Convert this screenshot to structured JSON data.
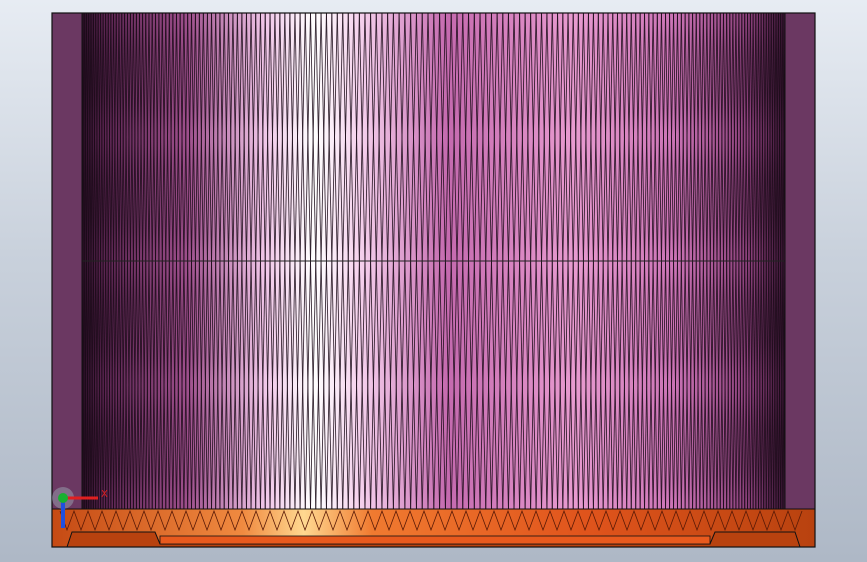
{
  "viewport": {
    "background_top": "#e7ecf3",
    "background_bottom": "#aeb8c6"
  },
  "model": {
    "body_color": "#e68fc9",
    "body_highlight": "#ffffff",
    "body_shadow": "#6b2f5e",
    "side_panel_color": "#6b3862",
    "base_color": "#e0541c",
    "base_highlight": "#ffcc70",
    "base_dark": "#b8420f",
    "outline_color": "#111111"
  },
  "triad": {
    "x_axis_label": "X",
    "x_axis_color": "#e02020",
    "y_axis_color": "#18b030",
    "z_axis_color": "#2050e0"
  }
}
